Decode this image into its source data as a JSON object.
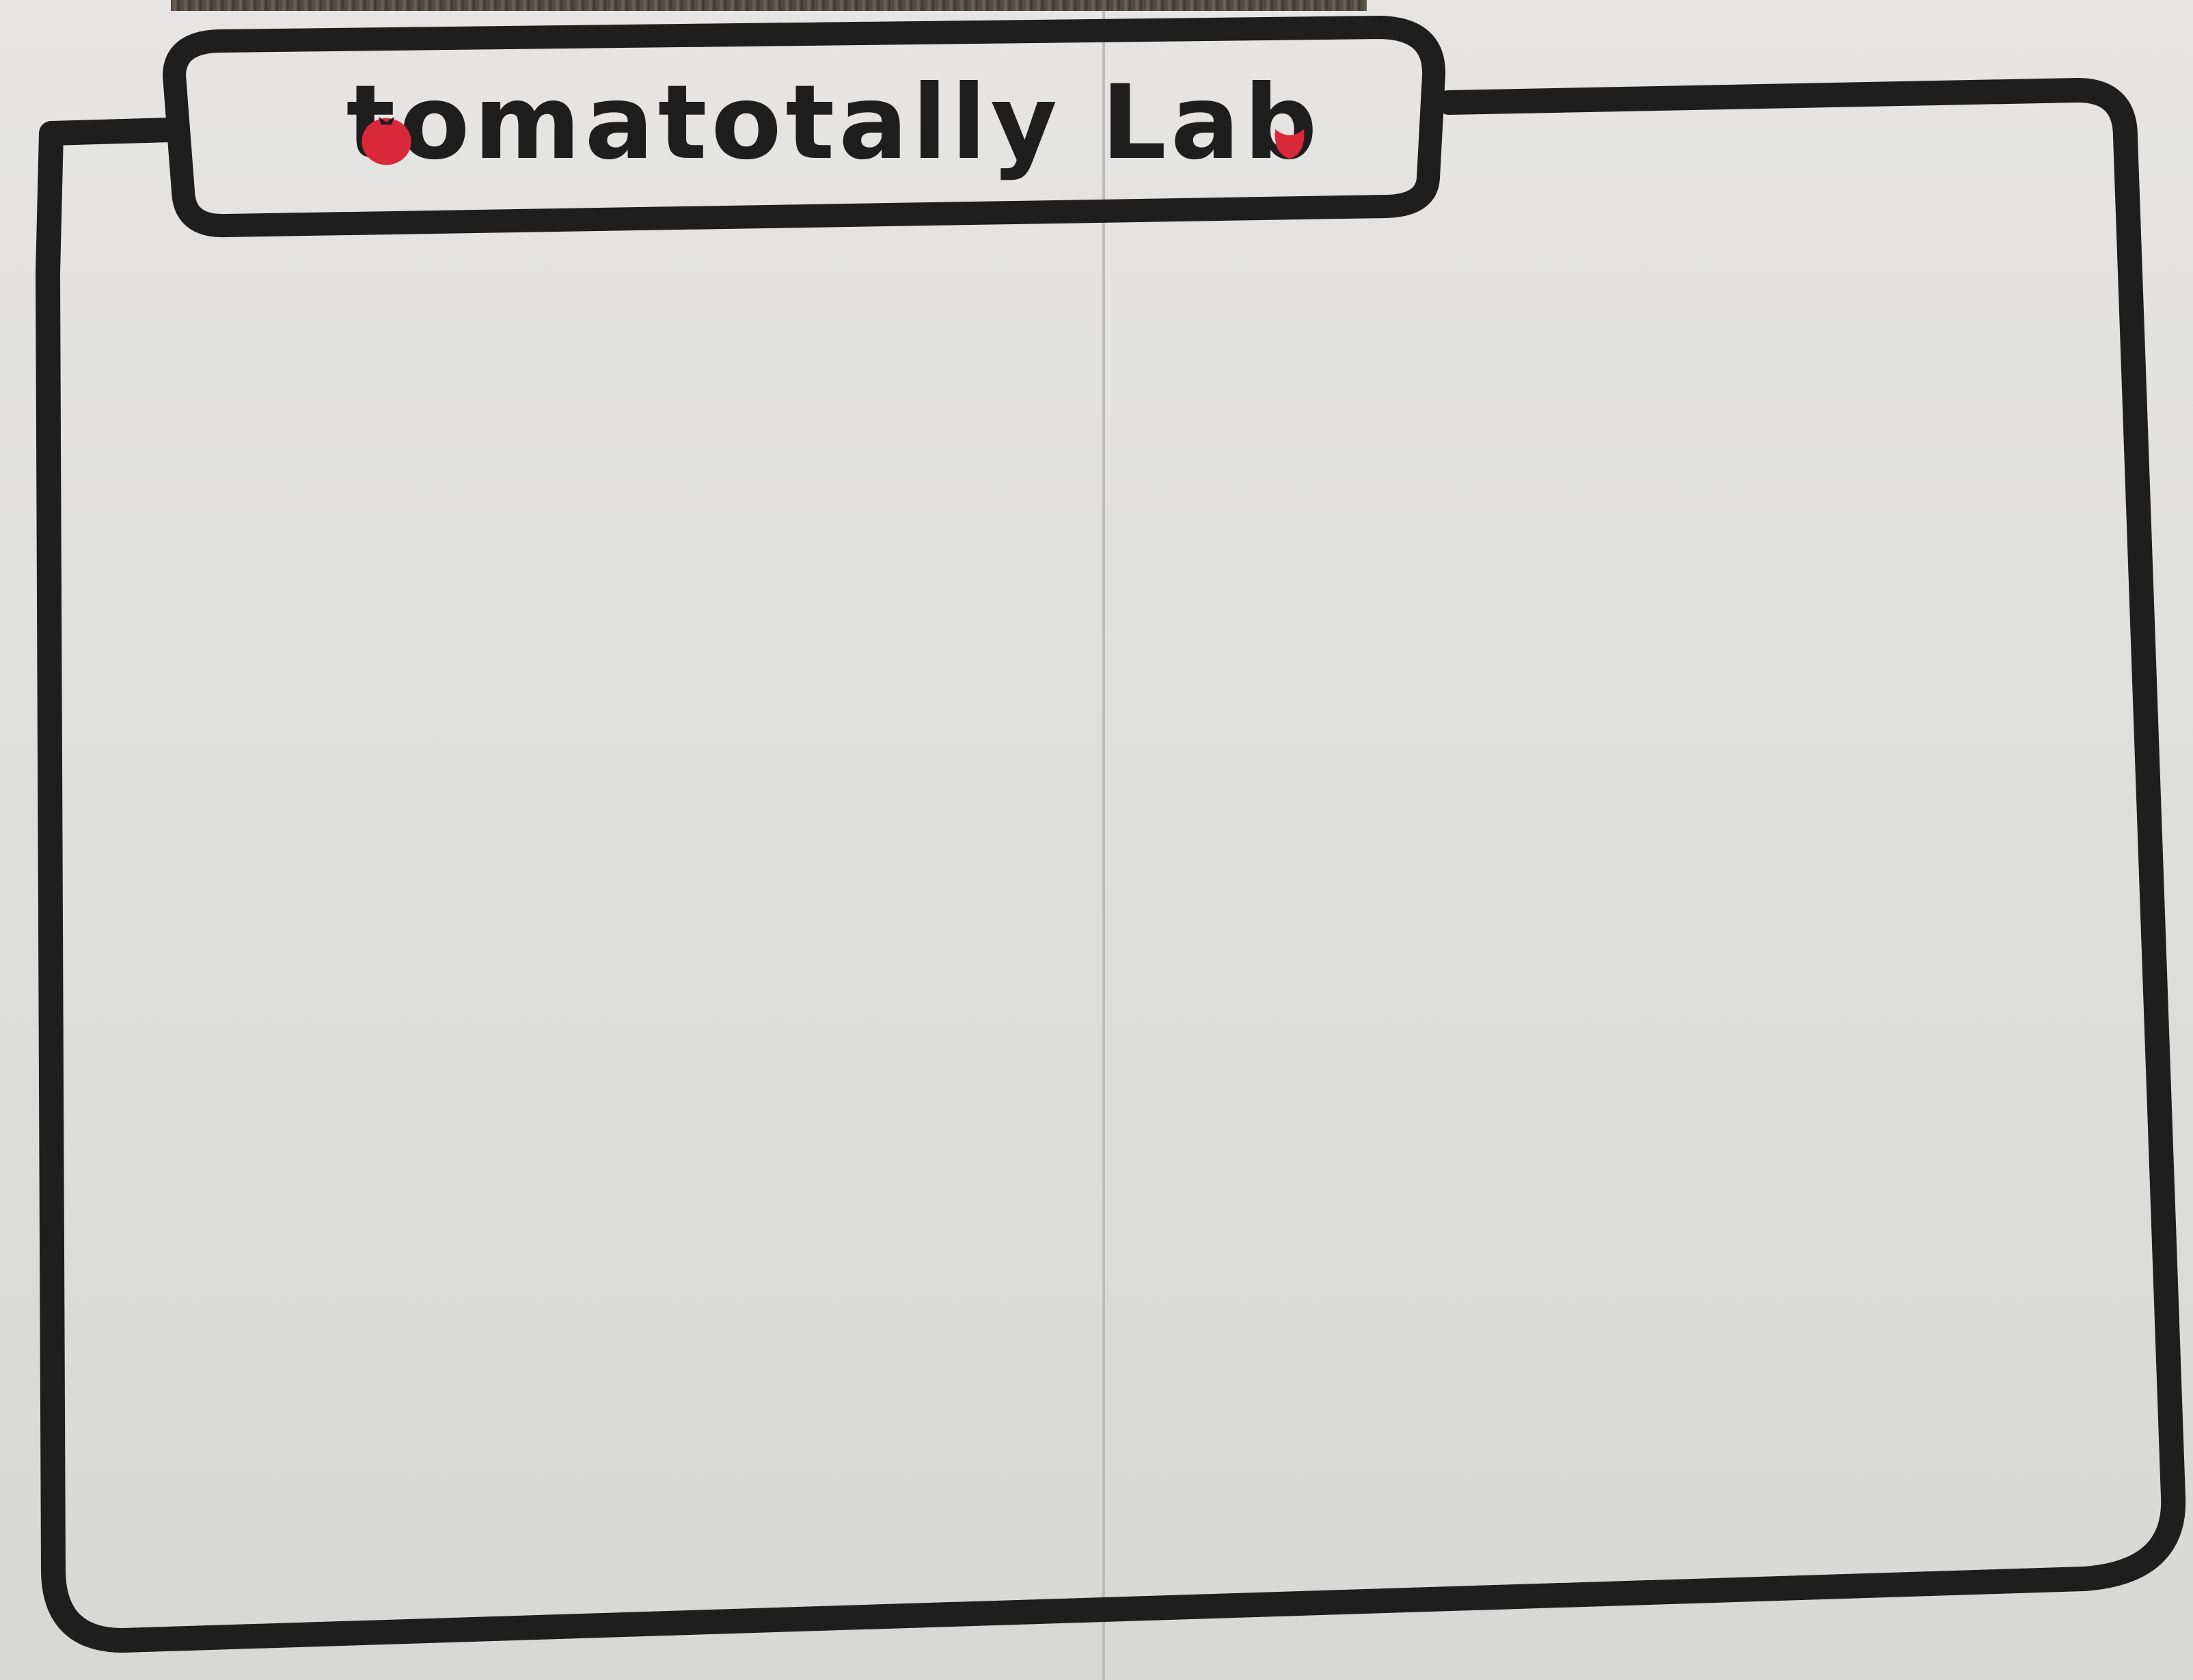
{
  "app": {
    "title": "tomatotally Lab"
  },
  "icons": {
    "title_icon_1": "tomato-icon",
    "title_icon_2": "tomato-icon"
  },
  "colors": {
    "ink": "#1e1e1e",
    "paper": "#e3e2e0",
    "tomato": "#d9283a"
  }
}
